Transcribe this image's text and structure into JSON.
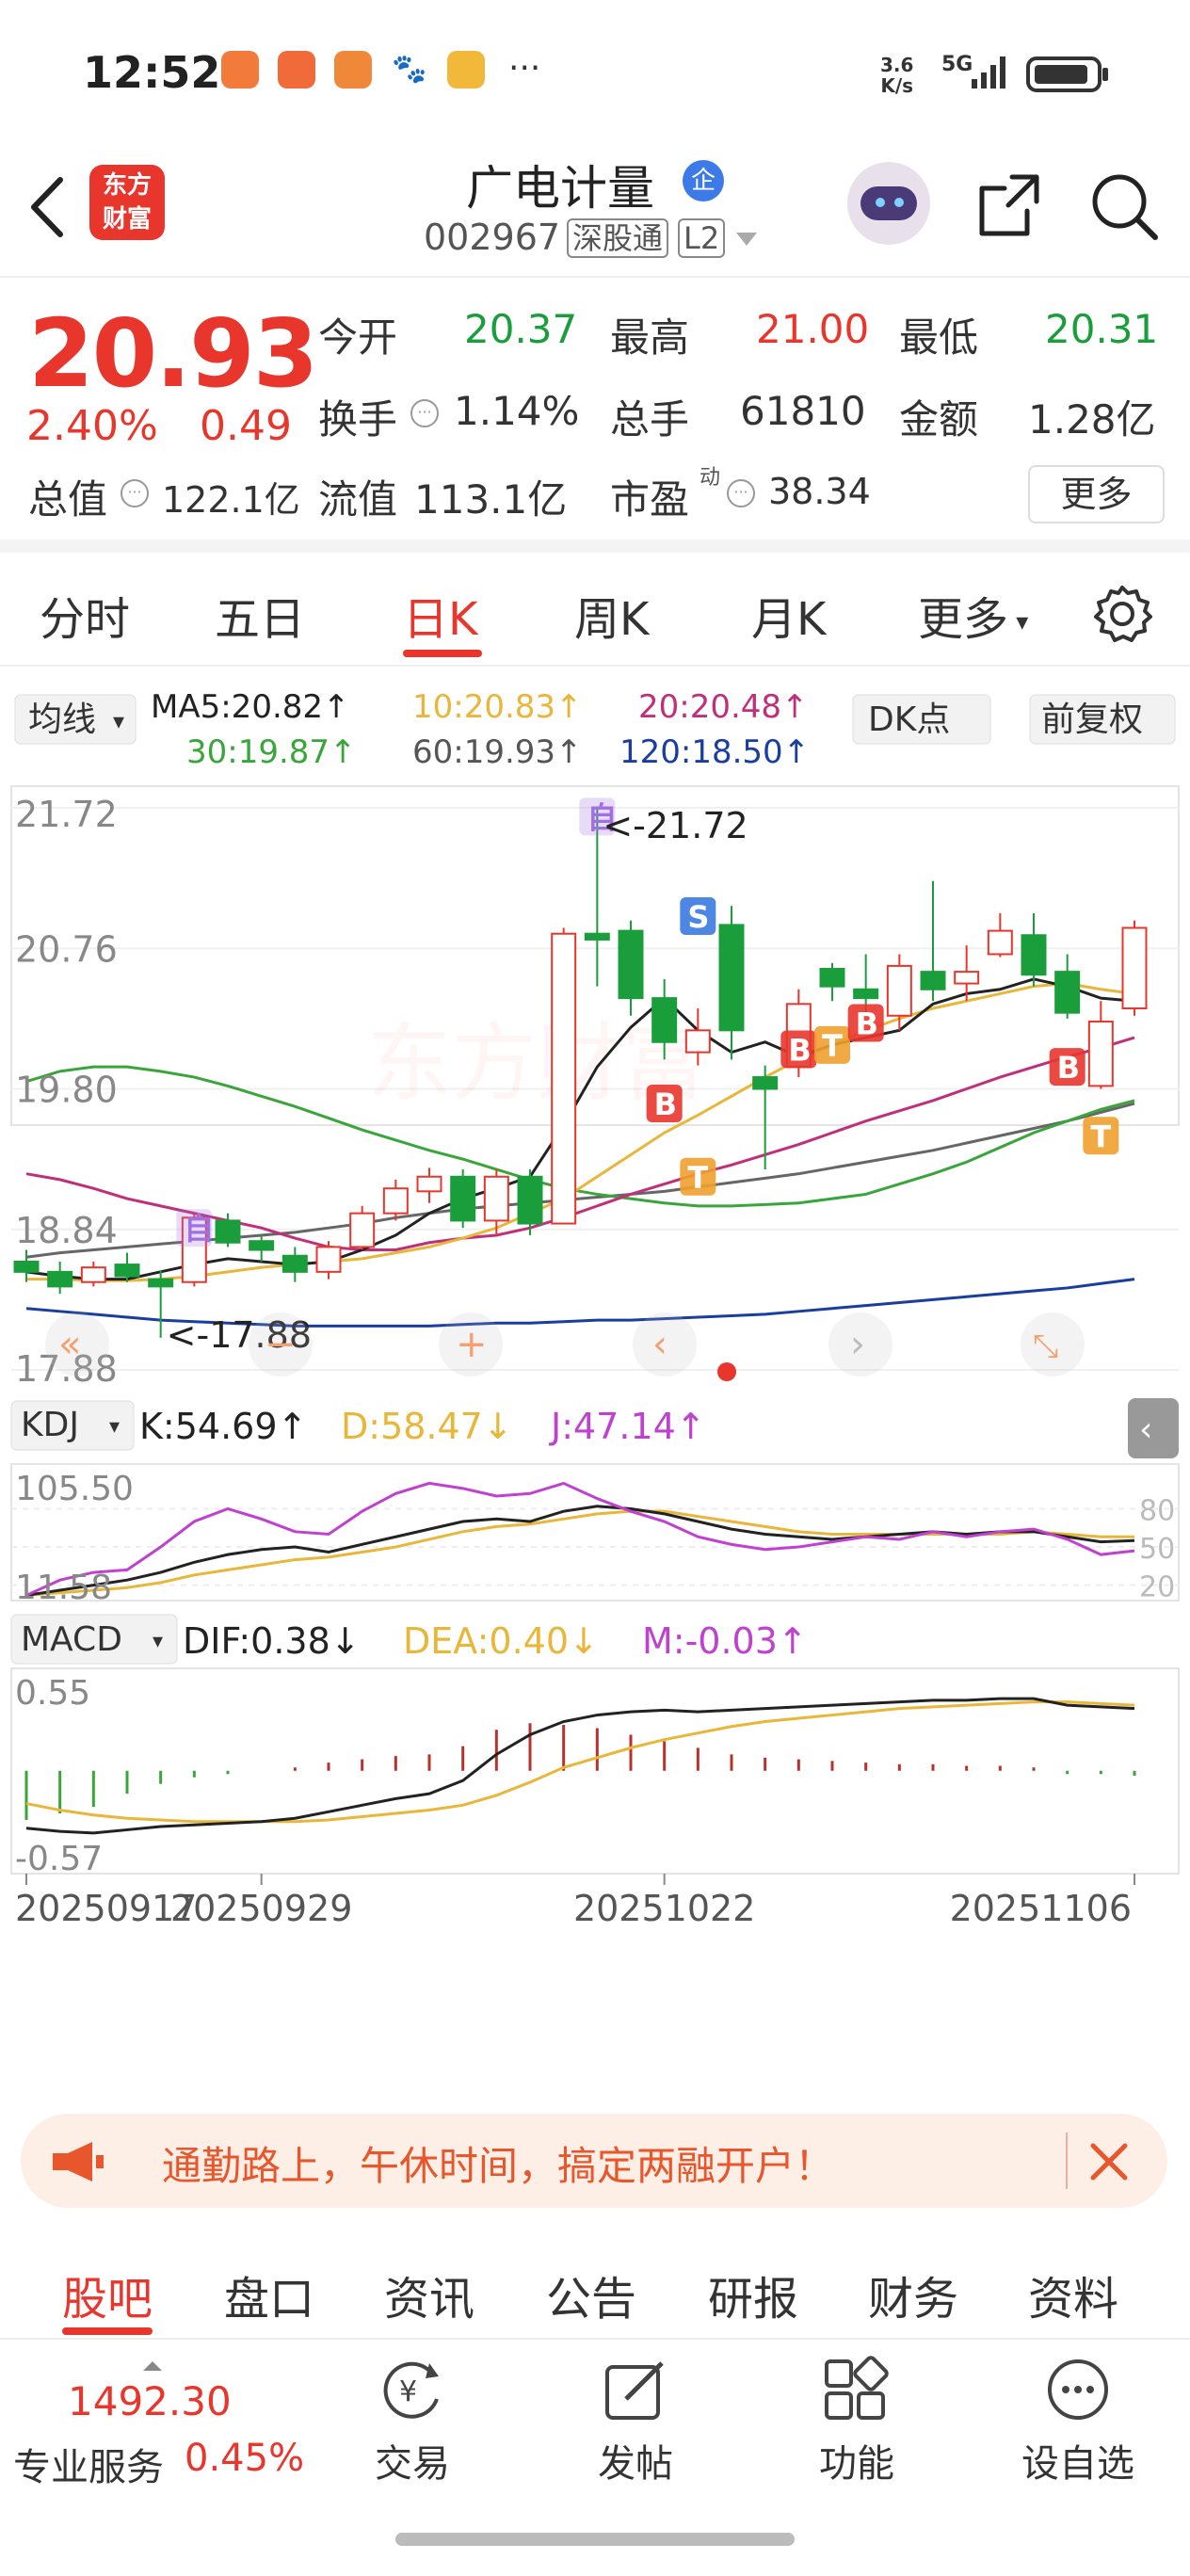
{
  "status_bar": {
    "time": "12:52",
    "net_speed_top": "3.6",
    "net_speed_bottom": "K/s",
    "signal": "5G"
  },
  "header": {
    "logo_line1": "东方",
    "logo_line2": "财富",
    "stock_name": "广电计量",
    "enterprise_badge": "企",
    "stock_code": "002967",
    "connect_badge": "深股通",
    "level_badge": "L2"
  },
  "quote": {
    "price": "20.93",
    "change_pct": "2.40%",
    "change_amt": "0.49",
    "open_label": "今开",
    "open": "20.37",
    "high_label": "最高",
    "high": "21.00",
    "low_label": "最低",
    "low": "20.31",
    "turnover_label": "换手",
    "turnover": "1.14%",
    "volume_label": "总手",
    "volume": "61810",
    "amount_label": "金额",
    "amount": "1.28亿",
    "mktcap_label": "总值",
    "mktcap": "122.1亿",
    "float_label": "流值",
    "float_cap": "113.1亿",
    "pe_label": "市盈",
    "pe_sup": "动",
    "pe": "38.34",
    "more_button": "更多"
  },
  "period_tabs": [
    "分时",
    "五日",
    "日K",
    "周K",
    "月K",
    "更多"
  ],
  "active_tab": "日K",
  "ma_bar": {
    "selector": "均线",
    "ma5": "MA5:20.82↑",
    "ma10": "10:20.83↑",
    "ma20": "20:20.48↑",
    "ma30": "30:19.87↑",
    "ma60": "60:19.93↑",
    "ma120": "120:18.50↑",
    "dk_button": "DK点",
    "adjust_button": "前复权"
  },
  "kline": {
    "y_labels": [
      "21.72",
      "20.76",
      "19.80",
      "18.84",
      "17.88"
    ],
    "max_annot": "<-21.72",
    "min_annot": "<-17.88",
    "marker_B": "B",
    "marker_T": "T",
    "marker_S": "S",
    "marker_self": "自"
  },
  "kdj": {
    "selector": "KDJ",
    "k": "K:54.69↑",
    "d": "D:58.47↓",
    "j": "J:47.14↑",
    "y_top": "105.50",
    "y_bottom": "11.58",
    "levels": [
      "80",
      "50",
      "20"
    ]
  },
  "macd": {
    "selector": "MACD",
    "dif": "DIF:0.38↓",
    "dea": "DEA:0.40↓",
    "m": "M:-0.03↑",
    "y_top": "0.55",
    "y_bottom": "-0.57"
  },
  "x_dates": [
    "20250917",
    "20250929",
    "20251022",
    "20251106"
  ],
  "banner": {
    "text": "通勤路上，午休时间，搞定两融开户！"
  },
  "bottom_tabs": [
    "股吧",
    "盘口",
    "资讯",
    "公告",
    "研报",
    "财务",
    "资料"
  ],
  "footer": {
    "index_value": "1492.30",
    "index_change": "0.45%",
    "service_label": "专业服务",
    "trade_label": "交易",
    "post_label": "发帖",
    "func_label": "功能",
    "watch_label": "设自选"
  },
  "colors": {
    "up": "#e8362c",
    "down": "#1a9e3c",
    "accent": "#e8362c",
    "ma5": "#222222",
    "ma10": "#e8b73a",
    "ma20": "#c0307a",
    "ma30": "#3aa53a",
    "ma60": "#666666",
    "ma120": "#1a3ea0"
  },
  "chart_data": {
    "type": "candlestick",
    "price_range": [
      17.88,
      21.72
    ],
    "candles_ohlc": [
      [
        18.62,
        18.55,
        18.7,
        18.48
      ],
      [
        18.55,
        18.45,
        18.62,
        18.4
      ],
      [
        18.48,
        18.58,
        18.62,
        18.45
      ],
      [
        18.6,
        18.52,
        18.68,
        18.48
      ],
      [
        18.5,
        18.45,
        18.56,
        18.1
      ],
      [
        18.48,
        18.92,
        18.95,
        18.45
      ],
      [
        18.9,
        18.75,
        18.95,
        18.72
      ],
      [
        18.76,
        18.7,
        18.8,
        18.62
      ],
      [
        18.66,
        18.55,
        18.72,
        18.48
      ],
      [
        18.55,
        18.72,
        18.76,
        18.5
      ],
      [
        18.72,
        18.95,
        19.0,
        18.7
      ],
      [
        18.95,
        19.12,
        19.18,
        18.9
      ],
      [
        19.1,
        19.2,
        19.26,
        19.02
      ],
      [
        19.2,
        18.9,
        19.25,
        18.85
      ],
      [
        18.9,
        19.2,
        19.25,
        18.8
      ],
      [
        19.2,
        18.88,
        19.25,
        18.8
      ],
      [
        18.88,
        20.86,
        20.9,
        18.88
      ],
      [
        20.86,
        20.82,
        21.72,
        20.5
      ],
      [
        20.88,
        20.42,
        20.95,
        20.3
      ],
      [
        20.42,
        20.12,
        20.55,
        20.0
      ],
      [
        20.05,
        20.2,
        20.35,
        19.96
      ],
      [
        20.92,
        20.2,
        21.05,
        20.0
      ],
      [
        19.88,
        19.8,
        19.96,
        19.25
      ],
      [
        19.95,
        20.38,
        20.48,
        19.88
      ],
      [
        20.62,
        20.5,
        20.66,
        20.4
      ],
      [
        20.48,
        20.42,
        20.72,
        20.3
      ],
      [
        20.3,
        20.64,
        20.72,
        20.2
      ],
      [
        20.6,
        20.48,
        21.22,
        20.4
      ],
      [
        20.52,
        20.6,
        20.78,
        20.4
      ],
      [
        20.72,
        20.88,
        21.0,
        20.7
      ],
      [
        20.85,
        20.58,
        21.0,
        20.5
      ],
      [
        20.6,
        20.32,
        20.72,
        20.28
      ],
      [
        19.82,
        20.26,
        20.4,
        19.8
      ],
      [
        20.35,
        20.9,
        20.95,
        20.3
      ]
    ],
    "ma5": [
      18.55,
      18.52,
      18.5,
      18.5,
      18.55,
      18.6,
      18.64,
      18.62,
      18.6,
      18.62,
      18.7,
      18.8,
      18.95,
      19.05,
      19.12,
      19.2,
      19.55,
      19.95,
      20.22,
      20.42,
      20.2,
      20.05,
      20.12,
      20.02,
      20.1,
      20.15,
      20.2,
      20.38,
      20.45,
      20.48,
      20.55,
      20.5,
      20.42,
      20.4
    ],
    "ma10": [
      18.5,
      18.5,
      18.49,
      18.49,
      18.5,
      18.52,
      18.55,
      18.58,
      18.6,
      18.62,
      18.64,
      18.68,
      18.72,
      18.78,
      18.85,
      18.95,
      19.05,
      19.2,
      19.35,
      19.5,
      19.62,
      19.75,
      19.88,
      20.0,
      20.1,
      20.2,
      20.28,
      20.35,
      20.4,
      20.45,
      20.5,
      20.52,
      20.48,
      20.45
    ],
    "ma20": [
      19.22,
      19.18,
      19.12,
      19.05,
      19.0,
      18.95,
      18.9,
      18.85,
      18.78,
      18.72,
      18.7,
      18.7,
      18.75,
      18.78,
      18.8,
      18.85,
      18.92,
      19.0,
      19.08,
      19.15,
      19.22,
      19.28,
      19.35,
      19.42,
      19.5,
      19.58,
      19.65,
      19.72,
      19.8,
      19.88,
      19.95,
      20.02,
      20.08,
      20.15
    ],
    "ma30": [
      19.85,
      19.92,
      19.95,
      19.95,
      19.92,
      19.88,
      19.82,
      19.75,
      19.68,
      19.6,
      19.52,
      19.45,
      19.38,
      19.32,
      19.25,
      19.18,
      19.12,
      19.08,
      19.05,
      19.02,
      19.0,
      19.0,
      19.01,
      19.02,
      19.05,
      19.08,
      19.15,
      19.22,
      19.3,
      19.4,
      19.5,
      19.58,
      19.66,
      19.72
    ],
    "ma60": [
      18.65,
      18.68,
      18.7,
      18.72,
      18.74,
      18.76,
      18.78,
      18.8,
      18.82,
      18.85,
      18.88,
      18.92,
      18.95,
      18.98,
      19.0,
      19.02,
      19.04,
      19.06,
      19.08,
      19.1,
      19.13,
      19.16,
      19.19,
      19.22,
      19.26,
      19.3,
      19.34,
      19.38,
      19.43,
      19.48,
      19.53,
      19.58,
      19.64,
      19.7
    ],
    "ma120": [
      18.3,
      18.28,
      18.26,
      18.24,
      18.22,
      18.21,
      18.2,
      18.19,
      18.18,
      18.18,
      18.18,
      18.18,
      18.18,
      18.19,
      18.2,
      18.2,
      18.21,
      18.22,
      18.22,
      18.23,
      18.24,
      18.25,
      18.26,
      18.28,
      18.3,
      18.32,
      18.34,
      18.36,
      18.38,
      18.4,
      18.42,
      18.44,
      18.47,
      18.5
    ],
    "kdj_range": [
      11.58,
      105.5
    ],
    "kdj_k": [
      12,
      16,
      20,
      24,
      30,
      38,
      44,
      48,
      50,
      46,
      52,
      58,
      64,
      70,
      72,
      70,
      78,
      82,
      80,
      76,
      70,
      64,
      60,
      58,
      56,
      58,
      60,
      62,
      60,
      62,
      62,
      58,
      54,
      55
    ],
    "kdj_d": [
      12,
      14,
      16,
      18,
      22,
      28,
      32,
      36,
      40,
      42,
      46,
      50,
      56,
      62,
      66,
      68,
      72,
      76,
      78,
      78,
      74,
      70,
      66,
      62,
      60,
      60,
      60,
      60,
      60,
      60,
      62,
      60,
      58,
      58
    ],
    "kdj_j": [
      12,
      24,
      30,
      32,
      50,
      70,
      80,
      72,
      62,
      60,
      78,
      92,
      100,
      96,
      90,
      92,
      100,
      88,
      78,
      70,
      58,
      52,
      48,
      50,
      54,
      58,
      56,
      62,
      58,
      62,
      64,
      56,
      44,
      47
    ],
    "macd_range": [
      -0.57,
      0.55
    ],
    "macd_dif": [
      -0.35,
      -0.37,
      -0.38,
      -0.36,
      -0.34,
      -0.33,
      -0.32,
      -0.31,
      -0.29,
      -0.25,
      -0.21,
      -0.17,
      -0.14,
      -0.06,
      0.1,
      0.22,
      0.3,
      0.34,
      0.36,
      0.37,
      0.36,
      0.37,
      0.38,
      0.39,
      0.4,
      0.41,
      0.42,
      0.43,
      0.43,
      0.44,
      0.44,
      0.4,
      0.39,
      0.38
    ],
    "macd_dea": [
      -0.2,
      -0.24,
      -0.27,
      -0.29,
      -0.3,
      -0.31,
      -0.31,
      -0.31,
      -0.31,
      -0.3,
      -0.28,
      -0.26,
      -0.24,
      -0.21,
      -0.15,
      -0.07,
      0.02,
      0.08,
      0.14,
      0.19,
      0.23,
      0.27,
      0.3,
      0.32,
      0.34,
      0.36,
      0.38,
      0.39,
      0.4,
      0.41,
      0.42,
      0.42,
      0.41,
      0.4
    ],
    "macd_m": [
      -0.3,
      -0.26,
      -0.22,
      -0.14,
      -0.08,
      -0.04,
      -0.02,
      0.0,
      0.02,
      0.05,
      0.07,
      0.09,
      0.1,
      0.15,
      0.25,
      0.29,
      0.28,
      0.26,
      0.22,
      0.18,
      0.14,
      0.1,
      0.08,
      0.07,
      0.06,
      0.05,
      0.04,
      0.04,
      0.03,
      0.03,
      0.02,
      -0.02,
      -0.02,
      -0.03
    ]
  }
}
